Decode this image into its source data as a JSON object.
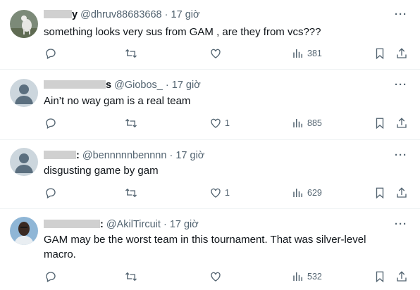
{
  "tweets": [
    {
      "handle": "@dhruv88683668",
      "sep": "·",
      "time": "17 giờ",
      "name_tail": "y",
      "text": "something looks very sus from GAM , are they from vcs???",
      "likes": "",
      "views": "381",
      "avatar": "photo-goat"
    },
    {
      "handle": "@Giobos_",
      "sep": "·",
      "time": "17 giờ",
      "name_tail": "s",
      "text": "Ain’t no way gam is a real team",
      "likes": "1",
      "views": "885",
      "avatar": "default"
    },
    {
      "handle": "@bennnnnbennnn",
      "sep": "·",
      "time": "17 giờ",
      "name_tail": ":",
      "text": "disgusting game by gam",
      "likes": "1",
      "views": "629",
      "avatar": "default"
    },
    {
      "handle": "@AkilTircuit",
      "sep": "·",
      "time": "17 giờ",
      "name_tail": ":",
      "text": "GAM may be the worst team in this tournament. That was silver-level macro.",
      "likes": "",
      "views": "532",
      "avatar": "photo-person"
    }
  ],
  "icons": {
    "reply": "reply-icon",
    "retweet": "retweet-icon",
    "like": "heart-icon",
    "views": "views-icon",
    "bookmark": "bookmark-icon",
    "share": "share-icon",
    "more": "more-icon"
  },
  "colors": {
    "text": "#0f1419",
    "muted": "#536471",
    "divider": "#eff3f4"
  }
}
